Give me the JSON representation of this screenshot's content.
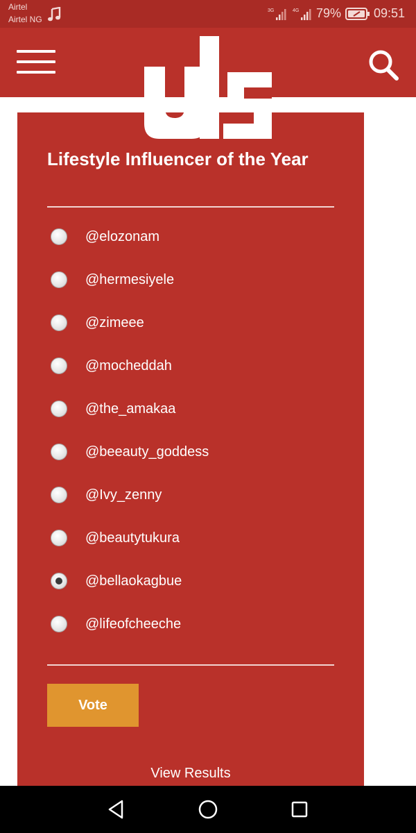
{
  "status_bar": {
    "carrier_line1": "Airtel",
    "carrier_line2": "Airtel NG",
    "network_3g": "3G",
    "network_4g": "4G",
    "battery_percent": "79%",
    "time": "09:51"
  },
  "header": {
    "logo_text": "uls",
    "menu_icon": "hamburger-menu-icon",
    "search_icon": "search-icon"
  },
  "poll": {
    "title": "Lifestyle Influencer of the Year",
    "options": [
      {
        "label": "@elozonam",
        "selected": false
      },
      {
        "label": "@hermesiyele",
        "selected": false
      },
      {
        "label": "@zimeee",
        "selected": false
      },
      {
        "label": "@mocheddah",
        "selected": false
      },
      {
        "label": "@the_amakaa",
        "selected": false
      },
      {
        "label": "@beeauty_goddess",
        "selected": false
      },
      {
        "label": "@Ivy_zenny",
        "selected": false
      },
      {
        "label": "@beautytukura",
        "selected": false
      },
      {
        "label": "@bellaokagbue",
        "selected": true
      },
      {
        "label": "@lifeofcheeche",
        "selected": false
      }
    ],
    "vote_label": "Vote",
    "view_results_label": "View Results"
  },
  "colors": {
    "brand_red": "#b9312a",
    "status_bar_red": "#a92b25",
    "vote_orange": "#e0952f"
  }
}
